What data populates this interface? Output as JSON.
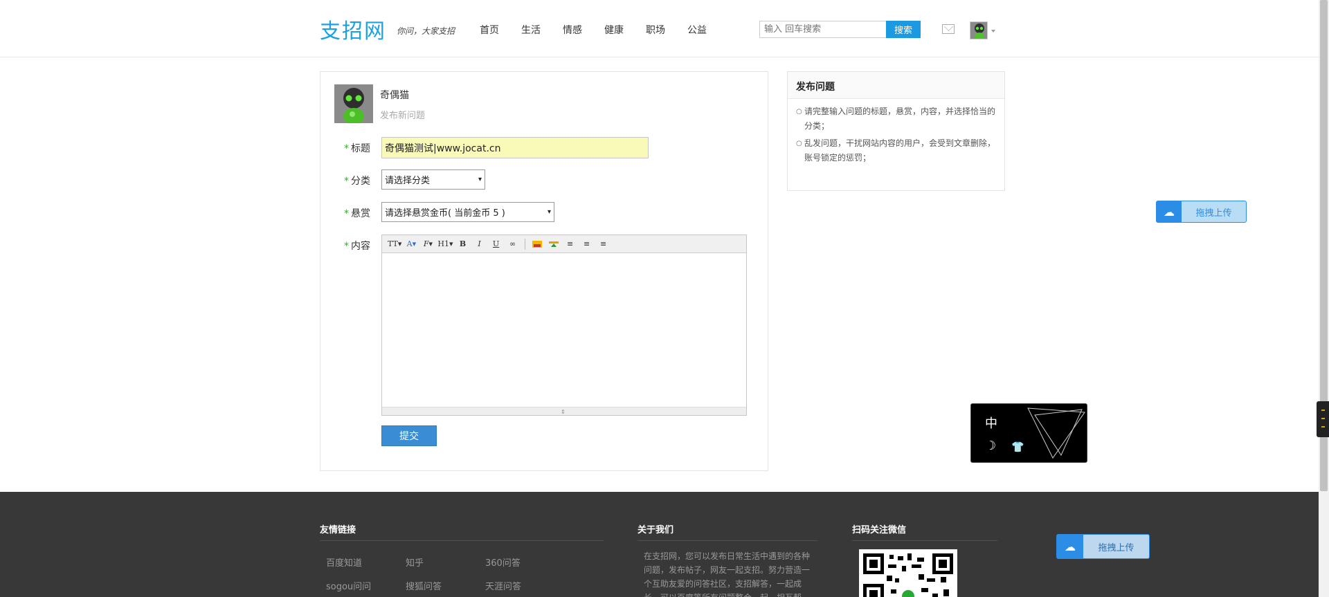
{
  "header": {
    "logo": "支招网",
    "slogan": "你问，大家支招",
    "nav": [
      "首页",
      "生活",
      "情感",
      "健康",
      "职场",
      "公益"
    ],
    "search_placeholder": "输入 回车搜索",
    "search_button": "搜索"
  },
  "form": {
    "username": "奇偶猫",
    "subtitle": "发布新问题",
    "labels": {
      "title": "标题",
      "category": "分类",
      "reward": "悬赏",
      "content": "内容",
      "required_mark": "*"
    },
    "title_value": "奇偶猫测试|www.jocat.cn",
    "category_selected": "请选择分类",
    "reward_selected": "请选择悬赏金币( 当前金币 5 )",
    "toolbar": [
      "TT",
      "A",
      "F",
      "H1",
      "B",
      "I",
      "U"
    ],
    "submit": "提交"
  },
  "side": {
    "title": "发布问题",
    "tips": [
      "请完整输入问题的标题，悬赏，内容，并选择恰当的分类；",
      "乱发问题，干扰网站内容的用户，会受到文章删除，账号锁定的惩罚；"
    ]
  },
  "widgets": {
    "drag_upload": "拖拽上传",
    "theme_lang": "中"
  },
  "footer": {
    "links_title": "友情链接",
    "links": [
      "百度知道",
      "知乎",
      "360问答",
      "sogou问问",
      "搜狐问答",
      "天涯问答"
    ],
    "about_title": "关于我们",
    "about_text": "在支招网，您可以发布日常生活中遇到的各种问题，发布帖子，网友一起支招。努力营造一个互助友爱的问答社区，支招解答，一起成长，可以百度等所有问题整合一起，相互帮",
    "wechat_title": "扫码关注微信"
  },
  "colors": {
    "brand": "#1ba1e2",
    "button": "#3a8dd3",
    "footer_bg": "#383838",
    "title_input_bg": "#fafab8"
  }
}
